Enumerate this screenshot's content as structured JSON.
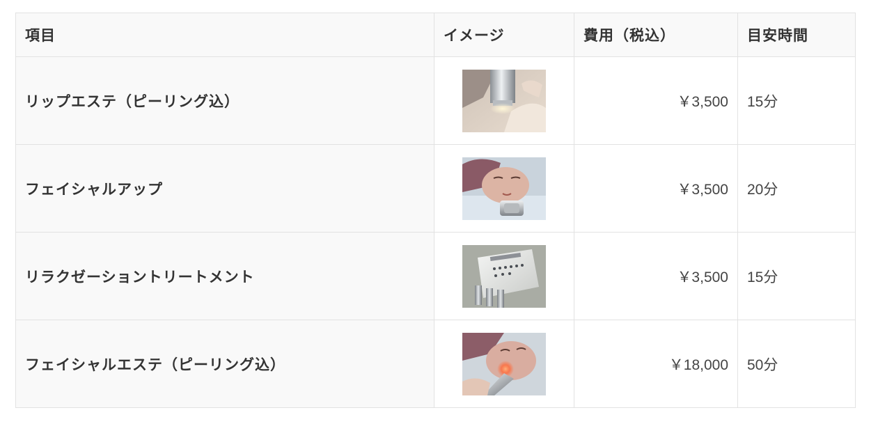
{
  "table": {
    "headers": {
      "item": "項目",
      "image": "イメージ",
      "price": "費用（税込）",
      "time": "目安時間"
    },
    "rows": [
      {
        "item": "リップエステ（ピーリング込）",
        "image": "lip-treatment-photo",
        "price": "￥3,500",
        "time": "15分"
      },
      {
        "item": "フェイシャルアップ",
        "image": "facial-up-photo",
        "price": "￥3,500",
        "time": "20分"
      },
      {
        "item": "リラクゼーショントリートメント",
        "image": "relaxation-device-photo",
        "price": "￥3,500",
        "time": "15分"
      },
      {
        "item": "フェイシャルエステ（ピーリング込）",
        "image": "facial-esthe-photo",
        "price": "￥18,000",
        "time": "50分"
      }
    ]
  },
  "colors": {
    "header_bg": "#f9f9f9",
    "border": "#e2e2e2",
    "text": "#333333"
  }
}
